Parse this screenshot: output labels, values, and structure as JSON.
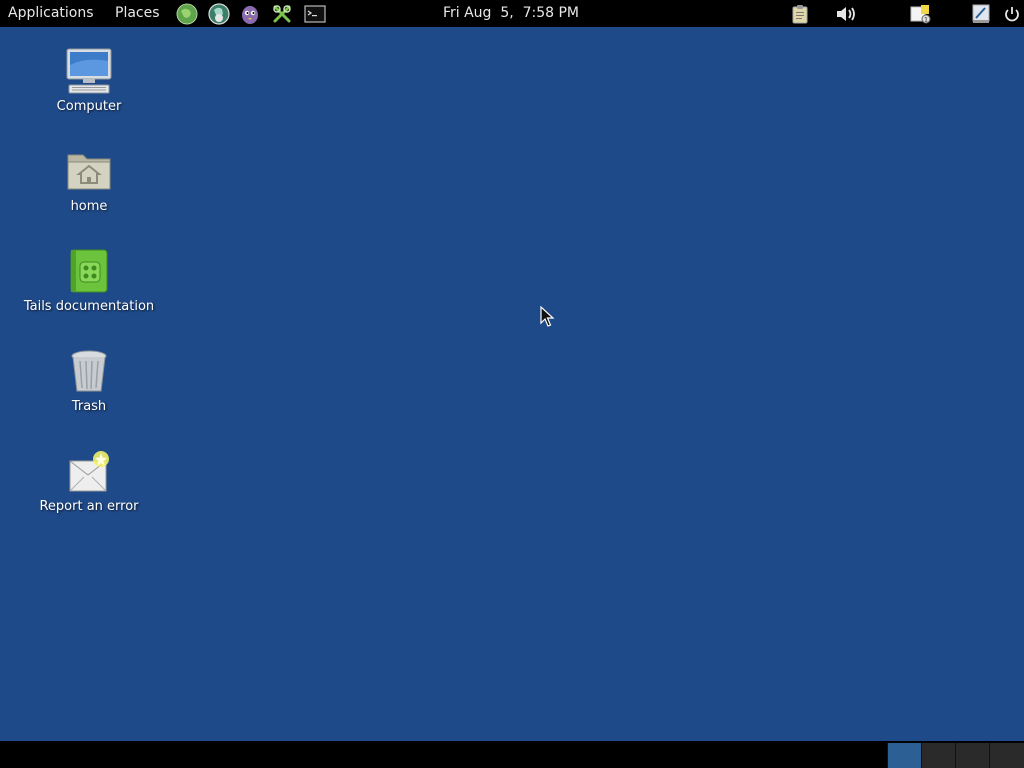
{
  "top_panel": {
    "applications_label": "Applications",
    "places_label": "Places",
    "launchers": [
      {
        "icon": "tor-browser-icon"
      },
      {
        "icon": "unsafe-browser-icon"
      },
      {
        "icon": "pidgin-icon"
      },
      {
        "icon": "keepassx-icon"
      },
      {
        "icon": "terminal-icon"
      }
    ],
    "clock": "Fri Aug  5,  7:58 PM",
    "tray": [
      {
        "icon": "clipboard-icon"
      },
      {
        "icon": "volume-icon"
      },
      {
        "icon": "notification-icon"
      },
      {
        "icon": "accessibility-icon"
      },
      {
        "icon": "power-icon"
      }
    ]
  },
  "desktop": {
    "icons": [
      {
        "label": "Computer",
        "icon": "computer-icon"
      },
      {
        "label": "home",
        "icon": "home-folder-icon"
      },
      {
        "label": "Tails documentation",
        "icon": "documentation-icon"
      },
      {
        "label": "Trash",
        "icon": "trash-icon"
      },
      {
        "label": "Report an error",
        "icon": "report-error-icon"
      }
    ]
  },
  "bottom_panel": {
    "workspaces": [
      "1",
      "2",
      "3",
      "4"
    ],
    "active_workspace": "1"
  },
  "colors": {
    "desktop_background": "#1f4a89",
    "panel_background": "#000000",
    "active_workspace": "#2c5f94"
  }
}
